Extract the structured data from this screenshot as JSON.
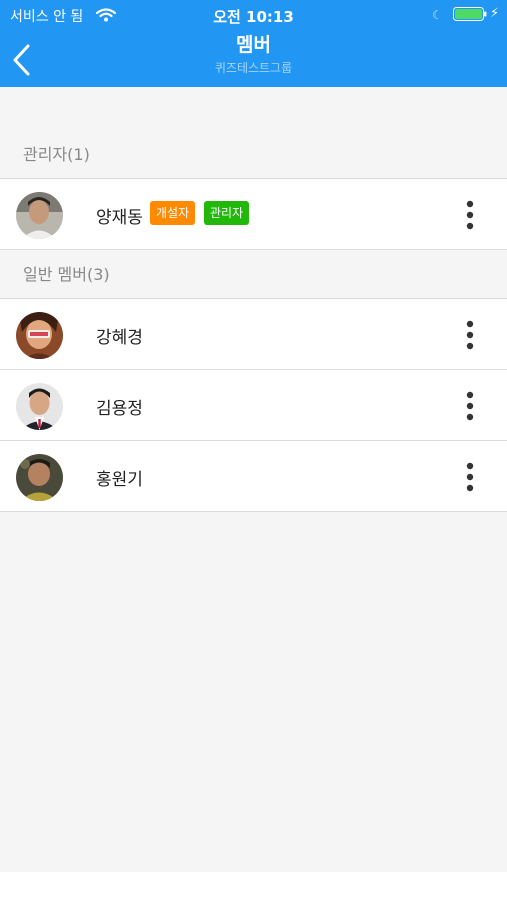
{
  "status_bar": {
    "carrier": "서비스 안 됨",
    "time": "오전 10:13",
    "icons": [
      "wifi-icon",
      "moon-icon",
      "battery-icon",
      "charging-bolt-icon"
    ]
  },
  "header": {
    "title": "멤버",
    "subtitle": "퀴즈테스트그룹",
    "back_icon": "chevron-left-icon",
    "color": "#2196f3"
  },
  "sections": [
    {
      "label": "관리자(1)",
      "members": [
        {
          "name": "양재동",
          "badges": [
            {
              "label": "개설자",
              "color": "#ff8a00"
            },
            {
              "label": "관리자",
              "color": "#22b80a"
            }
          ]
        }
      ]
    },
    {
      "label": "일반 멤버(3)",
      "members": [
        {
          "name": "강혜경",
          "badges": []
        },
        {
          "name": "김용정",
          "badges": []
        },
        {
          "name": "홍원기",
          "badges": []
        }
      ]
    }
  ],
  "row_action_icon": "more-vertical-icon"
}
